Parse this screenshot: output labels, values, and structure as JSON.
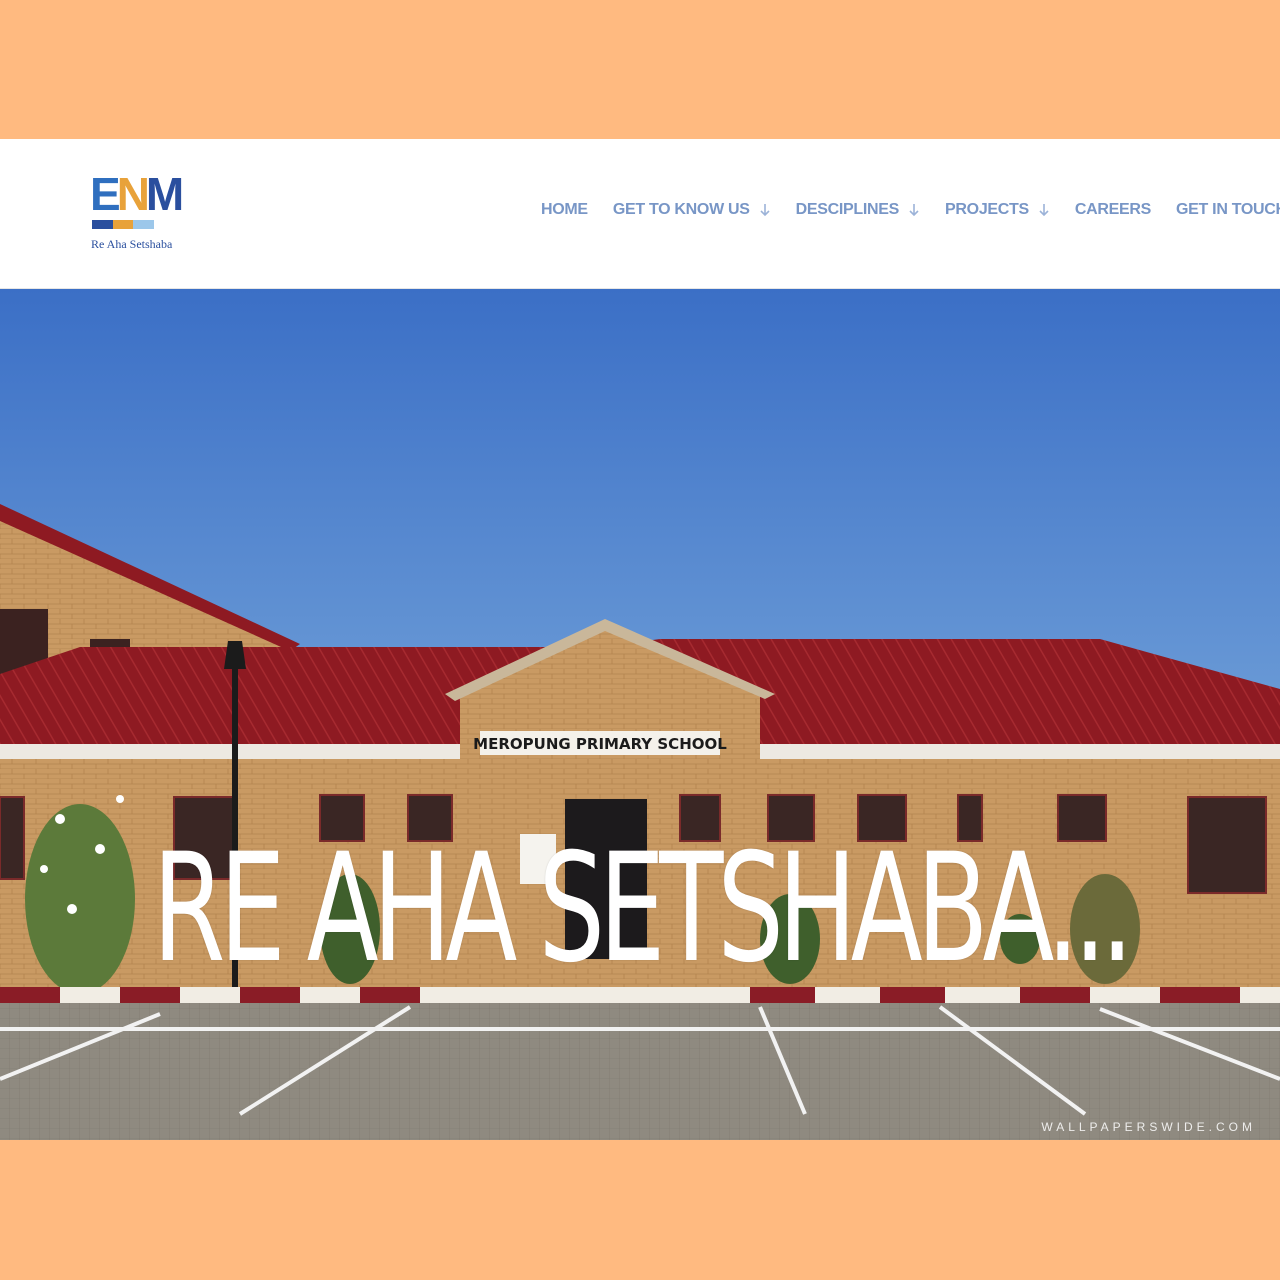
{
  "brand": {
    "mark_letters": [
      "E",
      "N",
      "M"
    ],
    "tagline": "Re Aha Setshaba",
    "colors": {
      "blue": "#2f6fbf",
      "orange": "#e8a23a",
      "navy": "#2a4f9e",
      "light": "#9cc7ea"
    }
  },
  "nav": {
    "items": [
      {
        "label": "HOME",
        "has_dropdown": false
      },
      {
        "label": "GET TO KNOW US",
        "has_dropdown": true
      },
      {
        "label": "DESCIPLINES",
        "has_dropdown": true
      },
      {
        "label": "PROJECTS",
        "has_dropdown": true
      },
      {
        "label": "CAREERS",
        "has_dropdown": false
      },
      {
        "label": "GET IN TOUCH",
        "has_dropdown": false
      }
    ],
    "color": "#7896c6"
  },
  "hero": {
    "title": "RE AHA SETSHABA...",
    "building_sign": "MEROPUNG PRIMARY SCHOOL",
    "image_description_icon": "school-building-photo"
  },
  "watermark": "WALLPAPERSWIDE.COM",
  "page_colors": {
    "border": "#FFBA80",
    "sky_top": "#3f74c9",
    "roof": "#8e1a22"
  }
}
